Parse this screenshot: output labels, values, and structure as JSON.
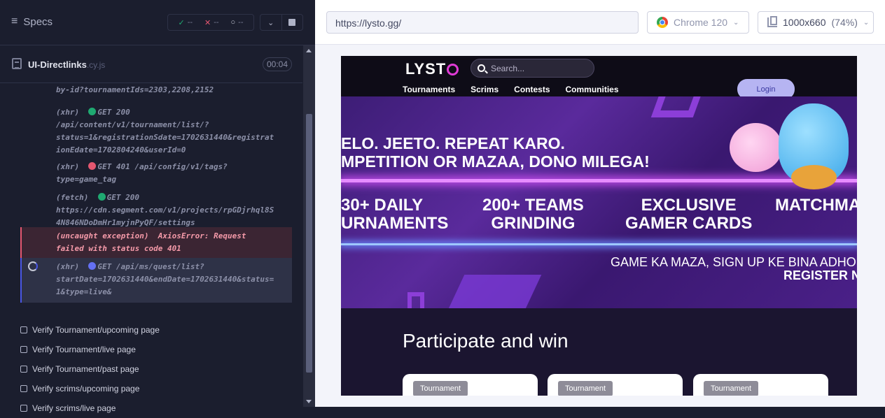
{
  "reporter": {
    "specs_label": "Specs",
    "stats": {
      "pass": "--",
      "fail": "--",
      "pending": "--"
    },
    "spec_file": {
      "name": "UI-Directlinks",
      "ext": ".cy.js",
      "duration": "00:04"
    },
    "log_entries": [
      {
        "lines": [
          "by-id?tournamentIds=2303,2208,2152"
        ]
      },
      {
        "type": "(xhr)",
        "status_color": "#1fa971",
        "method": "GET 200",
        "lines": [
          "/api/content/v1/tournament/list/?",
          "status=1&registrationSdate=1702631440&registrat",
          "ionEdate=1702804240&userId=0"
        ]
      },
      {
        "type": "(xhr)",
        "status_color": "#e45770",
        "method": "GET 401 /api/config/v1/tags?",
        "lines": [
          "type=game_tag"
        ]
      },
      {
        "type": "(fetch)",
        "status_color": "#1fa971",
        "method": "GET 200",
        "lines": [
          "https://cdn.segment.com/v1/projects/rpGDjrhql8S",
          "4N846NDoDmHr1myjnPyQF/settings"
        ]
      },
      {
        "type": "(uncaught exception)",
        "method": "AxiosError: Request",
        "lines": [
          "failed with status code 401"
        ]
      },
      {
        "type": "(xhr)",
        "status_color": "#6470f3",
        "method": "GET /api/ms/quest/list?",
        "lines": [
          "startDate=1702631440&endDate=1702631440&status=",
          "1&type=live&"
        ]
      }
    ],
    "tests": [
      "Verify Tournament/upcoming page",
      "Verify Tournament/live page",
      "Verify Tournament/past page",
      "Verify scrims/upcoming page",
      "Verify scrims/live page"
    ]
  },
  "runner": {
    "url": "https://lysto.gg/",
    "browser": "Chrome 120",
    "viewport": "1000x660",
    "scale": "(74%)"
  },
  "site": {
    "logo": "LYST",
    "search_placeholder": "Search...",
    "nav": [
      "Tournaments",
      "Scrims",
      "Contests",
      "Communities"
    ],
    "login": "Login",
    "hero_line1": "ELO. JEETO. REPEAT KARO.",
    "hero_line2": "MPETITION OR MAZAA, DONO MILEGA!",
    "stats": [
      {
        "l1": "30+ DAILY",
        "l2": "URNAMENTS"
      },
      {
        "l1": "200+ TEAMS",
        "l2": "GRINDING"
      },
      {
        "l1": "EXCLUSIVE",
        "l2": "GAMER CARDS"
      },
      {
        "l1": "MATCHMA",
        "l2": ""
      }
    ],
    "hero_bottom1": "GAME KA MAZA, SIGN UP KE BINA ADHO",
    "hero_bottom2": "REGISTER N",
    "section_title": "Participate and win",
    "card_tags": [
      "Tournament",
      "Tournament",
      "Tournament"
    ]
  }
}
